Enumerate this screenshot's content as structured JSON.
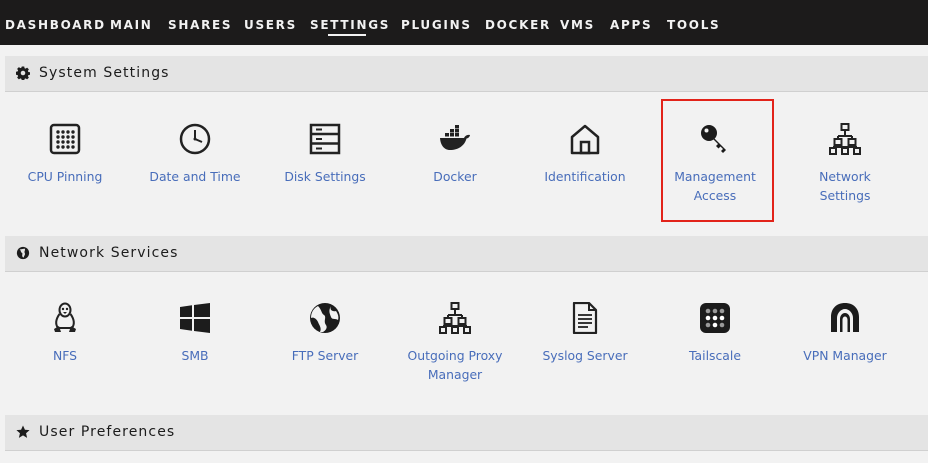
{
  "nav": {
    "items": [
      "DASHBOARD",
      "MAIN",
      "SHARES",
      "USERS",
      "SETTINGS",
      "PLUGINS",
      "DOCKER",
      "VMS",
      "APPS",
      "TOOLS"
    ],
    "active": "SETTINGS"
  },
  "sections": {
    "system": {
      "title": "System Settings",
      "icon": "gear-icon",
      "tiles": [
        {
          "label": "CPU Pinning",
          "icon": "cpu-icon"
        },
        {
          "label": "Date and Time",
          "icon": "clock-icon"
        },
        {
          "label": "Disk Settings",
          "icon": "disk-icon"
        },
        {
          "label": "Docker",
          "icon": "docker-icon"
        },
        {
          "label": "Identification",
          "icon": "home-icon"
        },
        {
          "label": "Management\nAccess",
          "icon": "key-icon"
        },
        {
          "label": "Network\nSettings",
          "icon": "network-icon"
        }
      ]
    },
    "network": {
      "title": "Network Services",
      "icon": "globe-icon",
      "tiles": [
        {
          "label": "NFS",
          "icon": "linux-icon"
        },
        {
          "label": "SMB",
          "icon": "windows-icon"
        },
        {
          "label": "FTP Server",
          "icon": "ftp-globe-icon"
        },
        {
          "label": "Outgoing Proxy\nManager",
          "icon": "proxy-network-icon"
        },
        {
          "label": "Syslog Server",
          "icon": "document-icon"
        },
        {
          "label": "Tailscale",
          "icon": "tailscale-icon"
        },
        {
          "label": "VPN Manager",
          "icon": "vpn-icon"
        }
      ]
    },
    "user": {
      "title": "User Preferences",
      "icon": "star-icon"
    }
  },
  "colors": {
    "nav_bg": "#1c1b1b",
    "link": "#486dba",
    "highlight": "#e2231a",
    "section_bg": "#e4e4e4"
  }
}
